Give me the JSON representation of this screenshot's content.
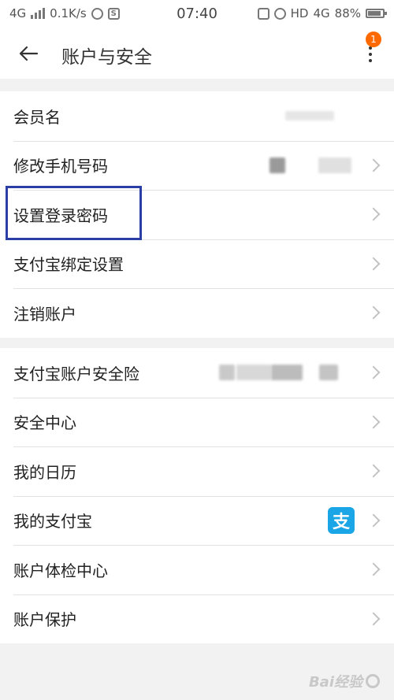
{
  "status": {
    "network_left": "4G",
    "speed": "0.1K/s",
    "time": "07:40",
    "hd": "HD",
    "network_right": "4G",
    "battery": "88%"
  },
  "header": {
    "title": "账户与安全",
    "badge": "1"
  },
  "group1": [
    {
      "label": "会员名"
    },
    {
      "label": "修改手机号码"
    },
    {
      "label": "设置登录密码"
    },
    {
      "label": "支付宝绑定设置"
    },
    {
      "label": "注销账户"
    }
  ],
  "group2": [
    {
      "label": "支付宝账户安全险"
    },
    {
      "label": "安全中心"
    },
    {
      "label": "我的日历"
    },
    {
      "label": "我的支付宝"
    },
    {
      "label": "账户体检中心"
    },
    {
      "label": "账户保护"
    }
  ],
  "icons": {
    "back": "back-arrow-icon",
    "more": "more-vertical-icon",
    "chevron": "chevron-right-icon",
    "alipay": "alipay-icon"
  },
  "alipay_glyph": "支",
  "watermark": "Bai经验",
  "colors": {
    "highlight": "#2b3ea6",
    "badge": "#ff6a00",
    "alipay": "#1aa5e6"
  }
}
